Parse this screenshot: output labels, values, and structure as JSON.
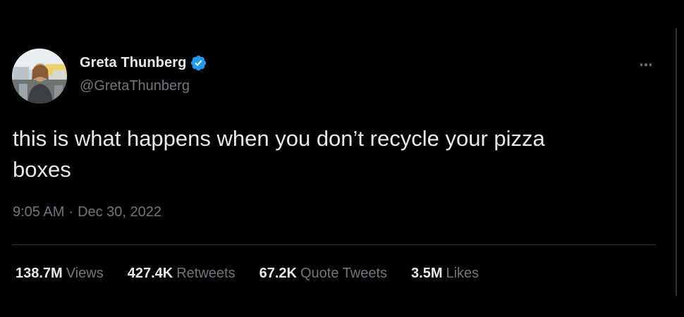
{
  "tweet": {
    "author": {
      "display_name": "Greta Thunberg",
      "handle": "@GretaThunberg",
      "verified": true
    },
    "text": "this is what happens when you don’t recycle your pizza\nboxes",
    "time": "9:05 AM",
    "separator": "·",
    "date": "Dec 30, 2022",
    "stats": {
      "views": {
        "value": "138.7M",
        "label": "Views"
      },
      "retweets": {
        "value": "427.4K",
        "label": "Retweets"
      },
      "quote_tweets": {
        "value": "67.2K",
        "label": "Quote Tweets"
      },
      "likes": {
        "value": "3.5M",
        "label": "Likes"
      }
    }
  },
  "icons": {
    "verified": "verified-badge-icon",
    "more": "more-options-icon",
    "avatar": "profile-avatar"
  },
  "colors": {
    "background": "#000000",
    "primary_text": "#e7e9ea",
    "secondary_text": "#71767b",
    "divider": "#2f3336",
    "verified_blue": "#1d9bf0"
  }
}
